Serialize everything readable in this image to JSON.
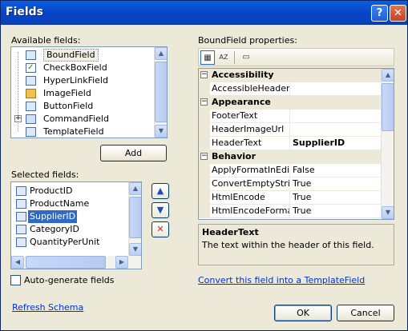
{
  "window": {
    "title": "Fields"
  },
  "titlebar": {
    "help_glyph": "?",
    "close_glyph": "✕"
  },
  "available_fields": {
    "label": "Available fields:",
    "items": [
      {
        "label": "BoundField",
        "icon": "bound-field-icon",
        "selected": true
      },
      {
        "label": "CheckBoxField",
        "icon": "checkbox-field-icon"
      },
      {
        "label": "HyperLinkField",
        "icon": "hyperlink-field-icon"
      },
      {
        "label": "ImageField",
        "icon": "image-field-icon"
      },
      {
        "label": "ButtonField",
        "icon": "button-field-icon"
      },
      {
        "label": "CommandField",
        "icon": "command-field-icon",
        "expandable": true
      },
      {
        "label": "TemplateField",
        "icon": "template-field-icon"
      }
    ],
    "expander_glyph": "+"
  },
  "add_button": {
    "label": "Add"
  },
  "selected_fields": {
    "label": "Selected fields:",
    "items": [
      {
        "label": "ProductID"
      },
      {
        "label": "ProductName"
      },
      {
        "label": "SupplierID",
        "selected": true
      },
      {
        "label": "CategoryID"
      },
      {
        "label": "QuantityPerUnit"
      }
    ]
  },
  "move_buttons": {
    "up_glyph": "▲",
    "down_glyph": "▼",
    "delete_glyph": "✕"
  },
  "auto_generate": {
    "label": "Auto-generate fields",
    "checked": false
  },
  "properties": {
    "label": "BoundField properties:",
    "toolbar": {
      "categorized_glyph": "▦",
      "alphabetical_glyph": "AZ",
      "pages_glyph": "▭"
    },
    "rows": [
      {
        "type": "category",
        "name": "Accessibility",
        "toggle": "−"
      },
      {
        "type": "property",
        "name": "AccessibleHeaderTe",
        "value": ""
      },
      {
        "type": "category",
        "name": "Appearance",
        "toggle": "−"
      },
      {
        "type": "property",
        "name": "FooterText",
        "value": ""
      },
      {
        "type": "property",
        "name": "HeaderImageUrl",
        "value": ""
      },
      {
        "type": "property",
        "name": "HeaderText",
        "value": "SupplierID",
        "bold": true
      },
      {
        "type": "category",
        "name": "Behavior",
        "toggle": "−"
      },
      {
        "type": "property",
        "name": "ApplyFormatInEditM",
        "value": "False"
      },
      {
        "type": "property",
        "name": "ConvertEmptyString",
        "value": "True"
      },
      {
        "type": "property",
        "name": "HtmlEncode",
        "value": "True"
      },
      {
        "type": "property",
        "name": "HtmlEncodeFormatS",
        "value": "True"
      }
    ],
    "description": {
      "title": "HeaderText",
      "text": "The text within the header of this field."
    }
  },
  "convert_link": {
    "label": "Convert this field into a TemplateField"
  },
  "refresh_link": {
    "label": "Refresh Schema"
  },
  "ok_button": {
    "label": "OK"
  },
  "cancel_button": {
    "label": "Cancel"
  },
  "scroll_glyphs": {
    "up": "▲",
    "down": "▼",
    "left": "◀",
    "right": "▶"
  }
}
